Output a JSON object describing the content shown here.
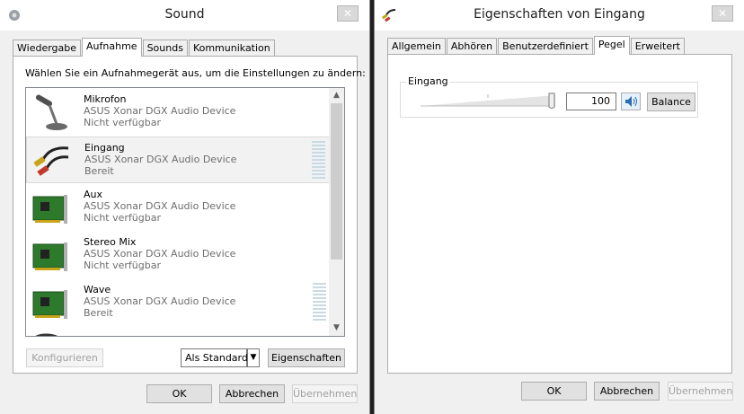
{
  "sound": {
    "title": "Sound",
    "close": "✕",
    "tabs": [
      "Wiedergabe",
      "Aufnahme",
      "Sounds",
      "Kommunikation"
    ],
    "instruction": "Wählen Sie ein Aufnahmegerät aus, um die Einstellungen zu ändern:",
    "devices": [
      {
        "name": "Mikrofon",
        "desc": "ASUS Xonar DGX Audio Device",
        "status": "Nicht verfügbar"
      },
      {
        "name": "Eingang",
        "desc": "ASUS Xonar DGX Audio Device",
        "status": "Bereit"
      },
      {
        "name": "Aux",
        "desc": "ASUS Xonar DGX Audio Device",
        "status": "Nicht verfügbar"
      },
      {
        "name": "Stereo Mix",
        "desc": "ASUS Xonar DGX Audio Device",
        "status": "Nicht verfügbar"
      },
      {
        "name": "Wave",
        "desc": "ASUS Xonar DGX Audio Device",
        "status": "Bereit"
      }
    ],
    "configure": "Konfigurieren",
    "set_default": "Als Standard",
    "properties": "Eigenschaften",
    "ok": "OK",
    "cancel": "Abbrechen",
    "apply": "Übernehmen"
  },
  "props": {
    "title": "Eigenschaften von Eingang",
    "close": "✕",
    "tabs": [
      "Allgemein",
      "Abhören",
      "Benutzerdefiniert",
      "Pegel",
      "Erweitert"
    ],
    "group_label": "Eingang",
    "volume": "100",
    "balance": "Balance",
    "ok": "OK",
    "cancel": "Abbrechen",
    "apply": "Übernehmen"
  }
}
